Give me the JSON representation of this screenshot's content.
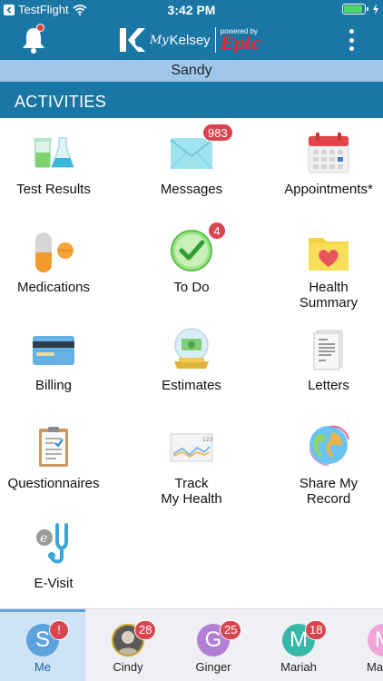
{
  "status_bar": {
    "carrier": "TestFlight",
    "time": "3:42 PM",
    "battery_level": 0.9
  },
  "header": {
    "logo_my": "My",
    "logo_kelsey": "Kelsey",
    "logo_powered": "powered by",
    "logo_epic": "Epic",
    "notification_icon": "bell-icon",
    "menu_icon": "kebab-menu-icon"
  },
  "patient_name": "Sandy",
  "activities_title": "ACTIVITIES",
  "activities": [
    {
      "label": "Test Results",
      "icon": "test-results-icon"
    },
    {
      "label": "Messages",
      "icon": "messages-icon",
      "badge": "983"
    },
    {
      "label": "Appointments*",
      "icon": "appointments-icon"
    },
    {
      "label": "Medications",
      "icon": "medications-icon"
    },
    {
      "label": "To Do",
      "icon": "to-do-icon",
      "badge": "4"
    },
    {
      "label": "Health\nSummary",
      "icon": "health-summary-icon"
    },
    {
      "label": "Billing",
      "icon": "billing-icon"
    },
    {
      "label": "Estimates",
      "icon": "estimates-icon"
    },
    {
      "label": "Letters",
      "icon": "letters-icon"
    },
    {
      "label": "Questionnaires",
      "icon": "questionnaires-icon"
    },
    {
      "label": "Track\nMy Health",
      "icon": "track-my-health-icon"
    },
    {
      "label": "Share My\nRecord",
      "icon": "share-my-record-icon"
    },
    {
      "label": "E-Visit",
      "icon": "e-visit-icon"
    }
  ],
  "proxies": [
    {
      "name": "Me",
      "initial": "S",
      "badge": "!",
      "color": "#5da2dc",
      "active": true
    },
    {
      "name": "Cindy",
      "initial": "",
      "badge": "28",
      "color": "#c9a227"
    },
    {
      "name": "Ginger",
      "initial": "G",
      "badge": "25",
      "color": "#b17fd6"
    },
    {
      "name": "Mariah",
      "initial": "M",
      "badge": "18",
      "color": "#36b8a9"
    },
    {
      "name": "Mar",
      "initial": "M",
      "badge": "",
      "color": "#f0a6d8"
    }
  ],
  "colors": {
    "primary": "#1a76a4",
    "name_bar": "#9fc6e8",
    "badge": "#d9454f"
  }
}
